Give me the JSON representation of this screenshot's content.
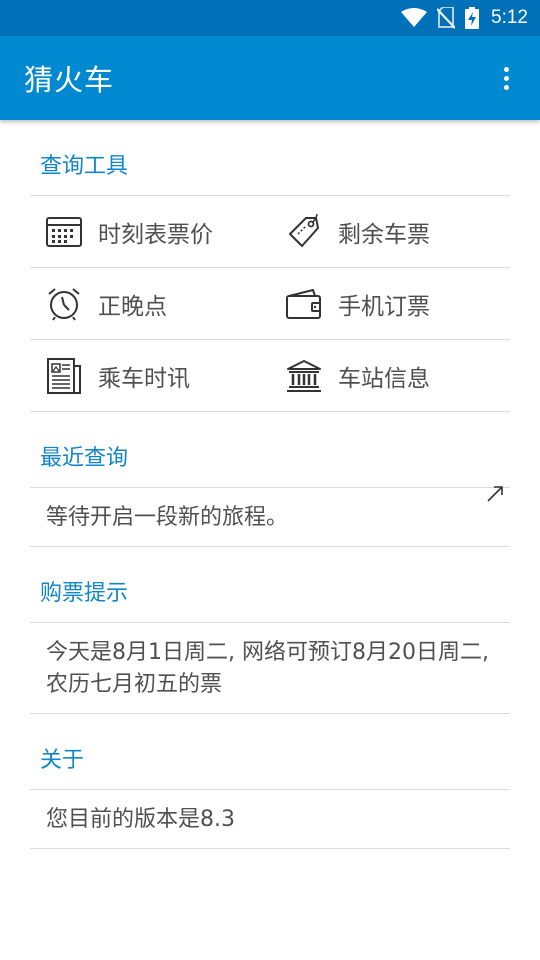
{
  "status_bar": {
    "time": "5:12",
    "icons": [
      "wifi-icon",
      "no-sim-icon",
      "battery-charging-icon"
    ]
  },
  "app_bar": {
    "title": "猜火车",
    "menu_icon": "overflow-menu-icon"
  },
  "sections": {
    "tools": {
      "title": "查询工具",
      "items": [
        {
          "label": "时刻表票价",
          "icon": "calendar-icon"
        },
        {
          "label": "剩余车票",
          "icon": "ticket-tag-icon"
        },
        {
          "label": "正晚点",
          "icon": "alarm-clock-icon"
        },
        {
          "label": "手机订票",
          "icon": "wallet-icon"
        },
        {
          "label": "乘车时讯",
          "icon": "newspaper-icon"
        },
        {
          "label": "车站信息",
          "icon": "station-building-icon"
        }
      ]
    },
    "recent": {
      "title": "最近查询",
      "text": "等待开启一段新的旅程。",
      "action_icon": "expand-arrow-icon"
    },
    "tips": {
      "title": "购票提示",
      "text": "今天是8月1日周二, 网络可预订8月20日周二, 农历七月初五的票"
    },
    "about": {
      "title": "关于",
      "text": "您目前的版本是8.3"
    }
  },
  "colors": {
    "status_bar": "#0071b9",
    "app_bar": "#0088d0",
    "section_title": "#1186c8"
  }
}
